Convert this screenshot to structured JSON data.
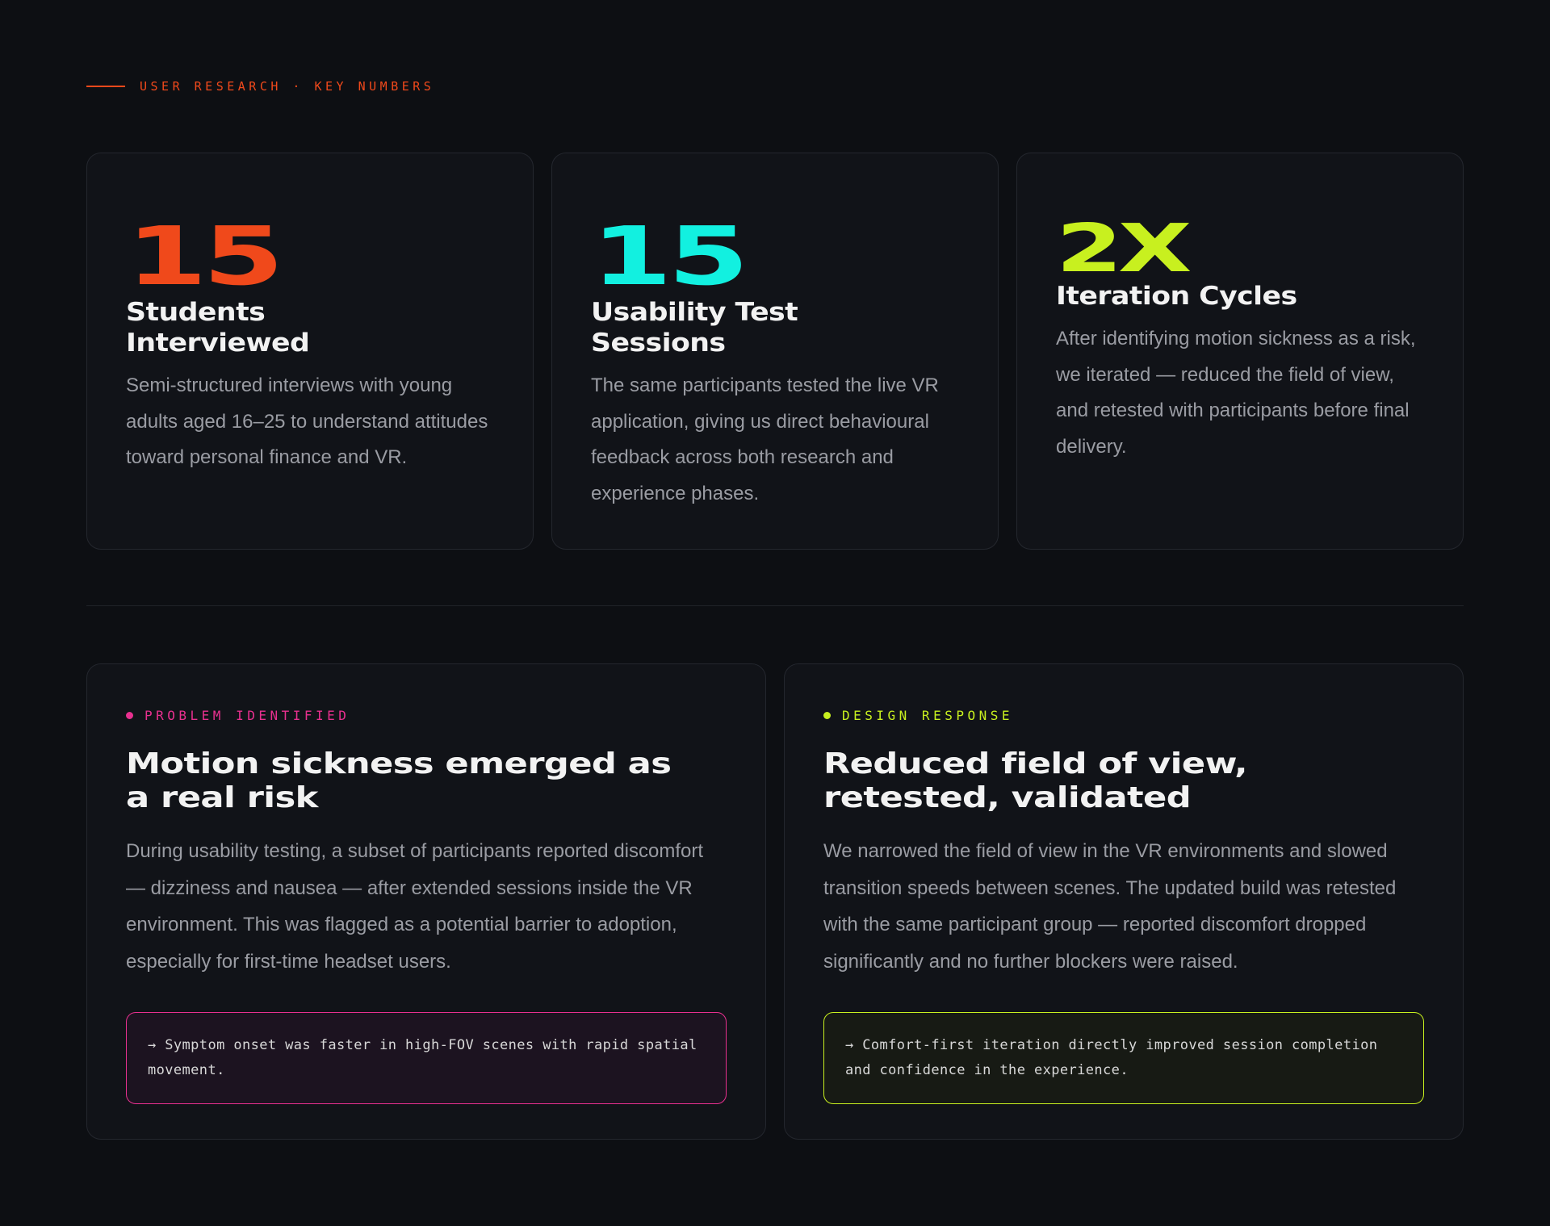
{
  "header": {
    "eyebrow": "USER RESEARCH · KEY NUMBERS"
  },
  "colors": {
    "orange": "#f0491b",
    "cyan": "#12f0e0",
    "lime": "#c8f01f",
    "pink": "#e8308f"
  },
  "stats": [
    {
      "value": "15",
      "title": "Students Interviewed",
      "description": "Semi-structured interviews with young adults aged 16–25 to understand attitudes toward personal finance and VR."
    },
    {
      "value": "15",
      "title": "Usability Test Sessions",
      "description": "The same participants tested the live VR application, giving us direct behavioural feedback across both research and experience phases."
    },
    {
      "value": "2X",
      "title": "Iteration Cycles",
      "description": "After identifying motion sickness as a risk, we iterated — reduced the field of view, and retested with participants before final delivery."
    }
  ],
  "problem": {
    "tag": "PROBLEM IDENTIFIED",
    "title": "Motion sickness emerged as a real risk",
    "description": "During usability testing, a subset of participants reported discomfort — dizziness and nausea — after extended sessions inside the VR environment. This was flagged as a potential barrier to adoption, especially for first-time headset users.",
    "callout": "→ Symptom onset was faster in high-FOV scenes with rapid spatial movement."
  },
  "response": {
    "tag": "DESIGN RESPONSE",
    "title": "Reduced field of view, retested, validated",
    "description": "We narrowed the field of view in the VR environments and slowed transition speeds between scenes. The updated build was retested with the same participant group — reported discomfort dropped significantly and no further blockers were raised.",
    "callout": "→ Comfort-first iteration directly improved session completion and confidence in the experience."
  }
}
